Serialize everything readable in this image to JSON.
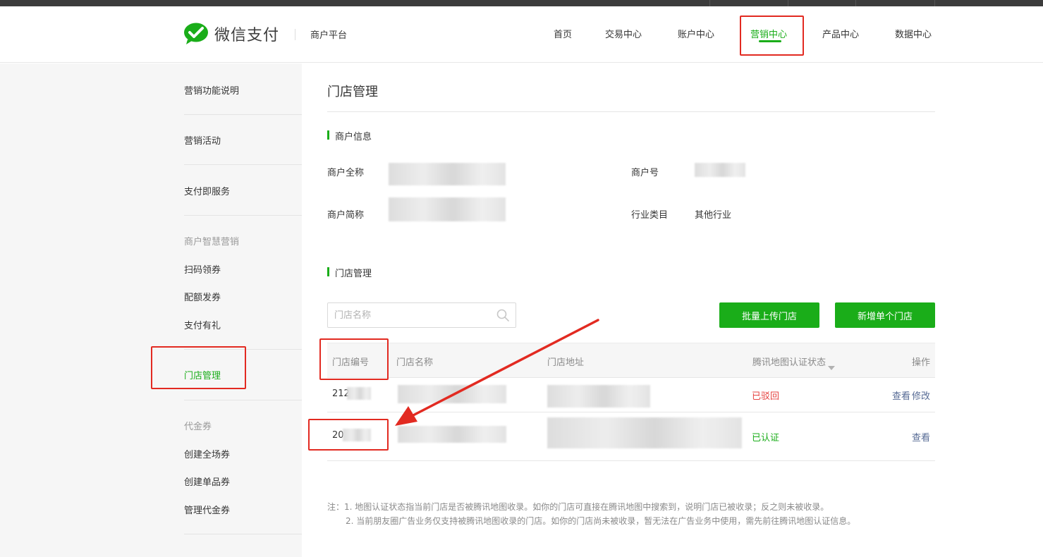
{
  "header": {
    "logo_text": "微信支付",
    "platform": "商户平台",
    "nav": [
      {
        "label": "首页",
        "active": false
      },
      {
        "label": "交易中心",
        "active": false
      },
      {
        "label": "账户中心",
        "active": false
      },
      {
        "label": "营销中心",
        "active": true
      },
      {
        "label": "产品中心",
        "active": false
      },
      {
        "label": "数据中心",
        "active": false
      }
    ]
  },
  "sidebar": {
    "items": [
      {
        "label": "营销功能说明"
      },
      {
        "label": "营销活动"
      },
      {
        "label": "支付即服务"
      }
    ],
    "group_smart": {
      "title": "商户智慧营销",
      "items": [
        {
          "label": "扫码领券"
        },
        {
          "label": "配额发券"
        },
        {
          "label": "支付有礼"
        }
      ]
    },
    "store_mgmt": {
      "label": "门店管理"
    },
    "group_coupon": {
      "title": "代金券",
      "items": [
        {
          "label": "创建全场券"
        },
        {
          "label": "创建单品券"
        },
        {
          "label": "管理代金券"
        }
      ]
    }
  },
  "main": {
    "title": "门店管理",
    "merchant_section": {
      "title": "商户信息",
      "full_name_label": "商户全称",
      "short_name_label": "商户简称",
      "merchant_id_label": "商户号",
      "industry_label": "行业类目",
      "industry_value": "其他行业"
    },
    "store_section": {
      "title": "门店管理",
      "search_placeholder": "门店名称",
      "batch_upload_label": "批量上传门店",
      "add_store_label": "新增单个门店"
    },
    "table": {
      "headers": [
        "门店编号",
        "门店名称",
        "门店地址",
        "腾讯地图认证状态",
        "操作"
      ],
      "rows": [
        {
          "id": "212",
          "status": "已驳回",
          "actions": [
            "查看",
            "修改"
          ]
        },
        {
          "id": "20",
          "status": "已认证",
          "actions": [
            "查看"
          ]
        }
      ]
    },
    "notes": [
      "注：1. 地图认证状态指当前门店是否被腾讯地图收录。如你的门店可直接在腾讯地图中搜索到，说明门店已被收录；反之则未被收录。",
      "2. 当前朋友圈广告业务仅支持被腾讯地图收录的门店。如你的门店尚未被收录，暂无法在广告业务中使用，需先前往腾讯地图认证信息。"
    ]
  },
  "colors": {
    "brand_green": "#1aad19",
    "rejected_red": "#e64340",
    "link_blue": "#576b95",
    "annotation_red": "#e22a21"
  },
  "icons": {
    "logo": "wechat-pay-logo-icon",
    "search": "search-icon",
    "sort": "sort-down-icon",
    "annotation": "red-arrow-icon"
  }
}
